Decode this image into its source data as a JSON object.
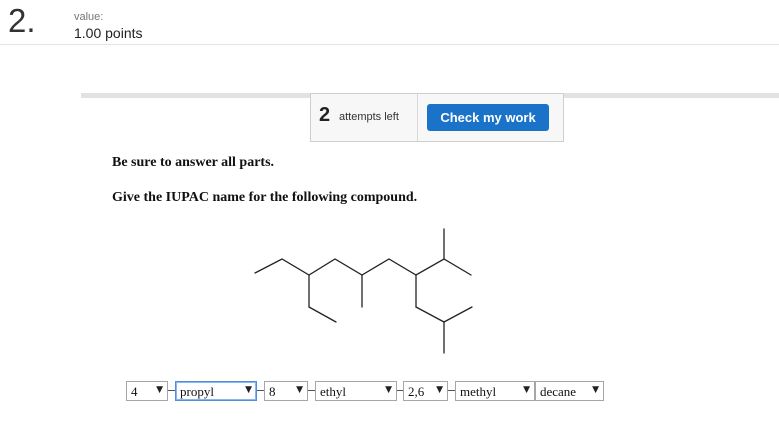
{
  "question": {
    "number": "2.",
    "value_label": "value:",
    "points": "1.00 points"
  },
  "toolbar": {
    "attempts_count": "2",
    "attempts_text": "attempts left",
    "check_label": "Check my work"
  },
  "instructions": [
    "Be sure to answer all parts.",
    "Give the IUPAC name for the following compound."
  ],
  "answer": {
    "selections": [
      {
        "value": "4"
      },
      {
        "value": "propyl"
      },
      {
        "value": "8"
      },
      {
        "value": "ethyl"
      },
      {
        "value": "2,6"
      },
      {
        "value": "methyl"
      },
      {
        "value": "decane"
      }
    ]
  },
  "colors": {
    "accent": "#1a73c9",
    "focus_border": "#4f8fe0"
  }
}
